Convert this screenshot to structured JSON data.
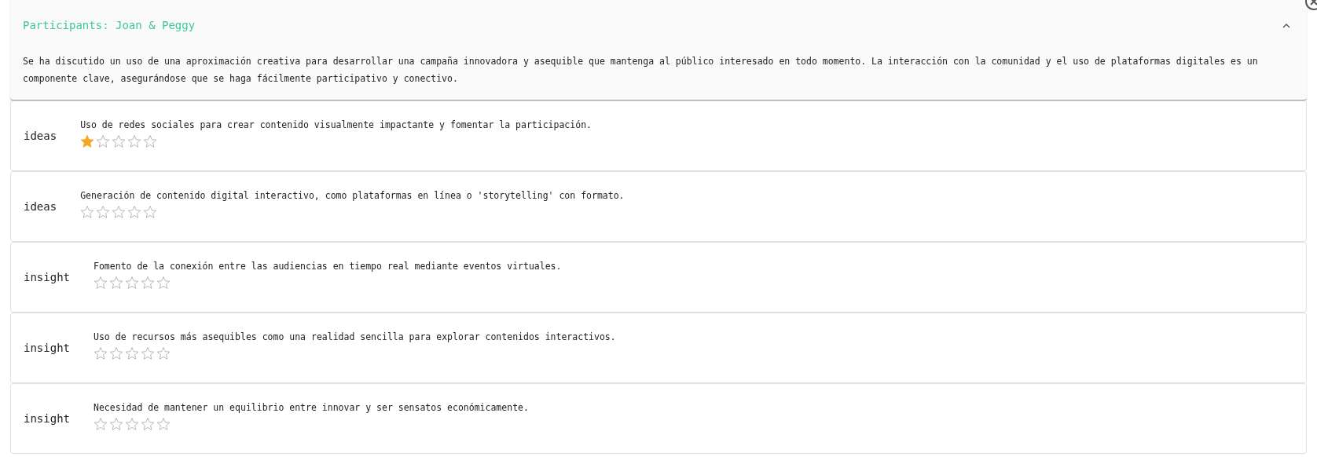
{
  "panel": {
    "title": "Participants: Joan & Peggy",
    "expanded": true,
    "summary": "Se ha discutido un uso de una aproximación creativa para desarrollar una campaña innovadora y asequible que mantenga al público interesado en todo momento. La interacción con la comunidad y el uso de plataformas digitales es un componente clave, asegurándose que se haga fácilmente participativo y conectivo."
  },
  "items": [
    {
      "category": "ideas",
      "text": "Uso de redes sociales para crear contenido visualmente impactante y fomentar la participación.",
      "stars": 1
    },
    {
      "category": "ideas",
      "text": "Generación de contenido digital interactivo, como plataformas en línea o 'storytelling' con formato.",
      "stars": 0
    },
    {
      "category": "insight",
      "text": "Fomento de la conexión entre las audiencias en tiempo real mediante eventos virtuales.",
      "stars": 0
    },
    {
      "category": "insight",
      "text": "Uso de recursos más asequibles como una realidad sencilla para explorar contenidos interactivos.",
      "stars": 0
    },
    {
      "category": "insight",
      "text": "Necesidad de mantener un equilibrio entre innovar y ser sensatos económicamente.",
      "stars": 0
    }
  ]
}
